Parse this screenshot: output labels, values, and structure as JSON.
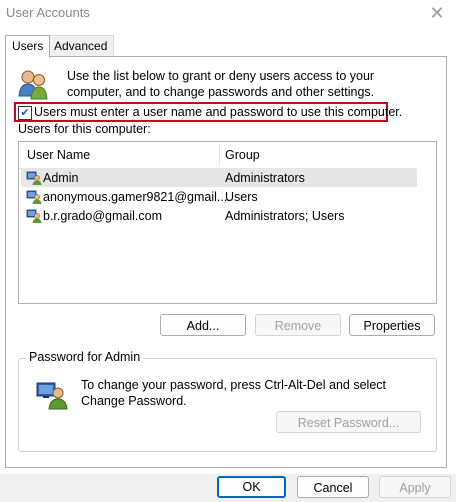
{
  "window": {
    "title": "User Accounts",
    "close_glyph": "✕"
  },
  "tabs": [
    {
      "label": "Users",
      "active": true
    },
    {
      "label": "Advanced",
      "active": false
    }
  ],
  "intro": "Use the list below to grant or deny users access to your computer, and to change passwords and other settings.",
  "require_login": {
    "label": "Users must enter a user name and password to use this computer.",
    "checked": true
  },
  "users_label": "Users for this computer:",
  "table": {
    "columns": [
      "User Name",
      "Group"
    ],
    "rows": [
      {
        "name": "Admin",
        "group": "Administrators",
        "selected": true
      },
      {
        "name": "anonymous.gamer9821@gmail....",
        "group": "Users",
        "selected": false
      },
      {
        "name": "b.r.grado@gmail.com",
        "group": "Administrators; Users",
        "selected": false
      }
    ]
  },
  "list_buttons": {
    "add": "Add...",
    "remove": "Remove",
    "properties": "Properties"
  },
  "password_group": {
    "title": "Password for Admin",
    "text": "To change your password, press Ctrl-Alt-Del and select Change Password.",
    "reset": "Reset Password..."
  },
  "dialog_buttons": {
    "ok": "OK",
    "cancel": "Cancel",
    "apply": "Apply"
  },
  "colors": {
    "highlight_box": "#d0021b",
    "selection_row": "#e6e6e6",
    "primary_border": "#0067c0"
  },
  "icons": [
    "users-group-icon",
    "user-icon",
    "admin-user-icon",
    "checkmark-icon",
    "close-icon"
  ]
}
